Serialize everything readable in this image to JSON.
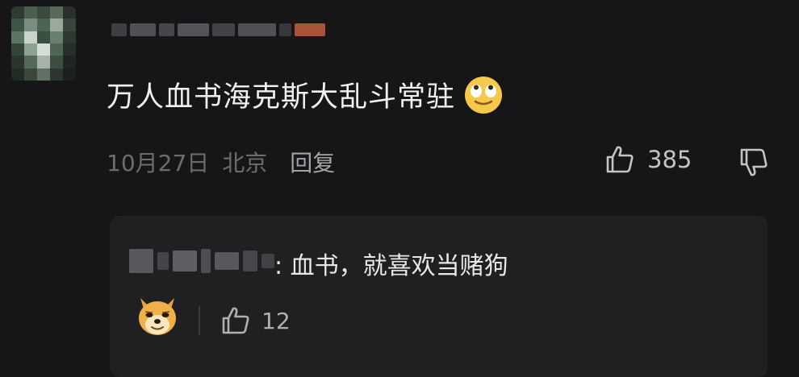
{
  "comment": {
    "text": "万人血书海克斯大乱斗常驻",
    "date": "10月27日",
    "location": "北京",
    "reply_label": "回复",
    "like_count": "385",
    "emoji": "rolling-eyes-face-emoji"
  },
  "reply": {
    "text": ": 血书，就喜欢当赌狗",
    "sticker": "doge-sticker",
    "like_count": "12"
  },
  "colors": {
    "background": "#161618",
    "reply_background": "#202023",
    "primary_text": "#f1f1f3",
    "secondary_text": "#6c6c70"
  }
}
